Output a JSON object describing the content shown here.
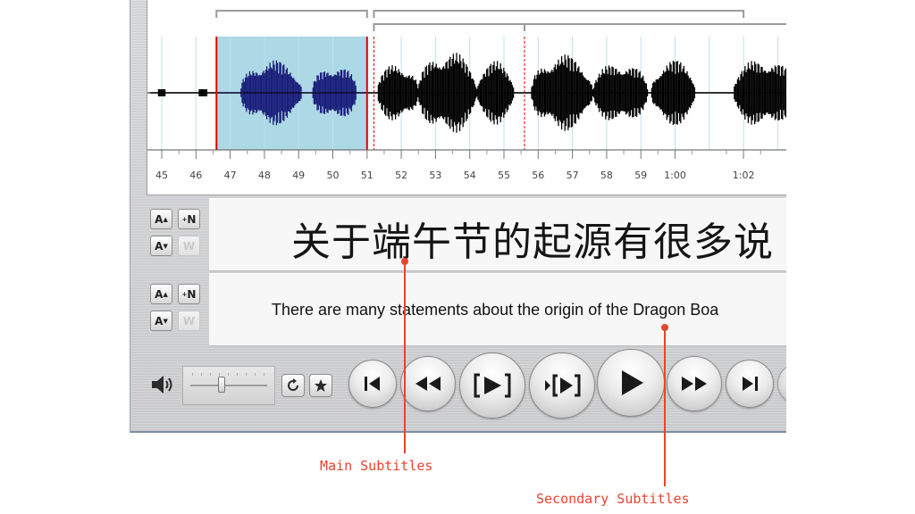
{
  "waveform": {
    "time_labels": [
      "45",
      "46",
      "47",
      "48",
      "49",
      "50",
      "51",
      "52",
      "53",
      "54",
      "55",
      "56",
      "57",
      "58",
      "59",
      "1:00",
      "1:02"
    ],
    "selection_color": "#add8e6",
    "wave_color_selected": "#1b1f7a",
    "wave_color": "#000000",
    "marker_color": "#e00000"
  },
  "main_subtitle": {
    "text": "关于端午节的起源有很多说",
    "buttons": {
      "font_up": "A",
      "insert_new": "N",
      "font_down": "A",
      "disabled": "W"
    }
  },
  "secondary_subtitle": {
    "text": "There are many statements about the origin of the Dragon Boa",
    "buttons": {
      "font_up": "A",
      "insert_new": "N",
      "font_down": "A",
      "disabled": "W"
    }
  },
  "controls": {
    "volume_icon": "speaker-icon",
    "volume_level": 0.4,
    "loop_icon": "loop-icon",
    "bookmark_icon": "star-icon"
  },
  "annotations": {
    "main": "Main Subtitles",
    "secondary": "Secondary Subtitles",
    "color": "#e8442c"
  }
}
